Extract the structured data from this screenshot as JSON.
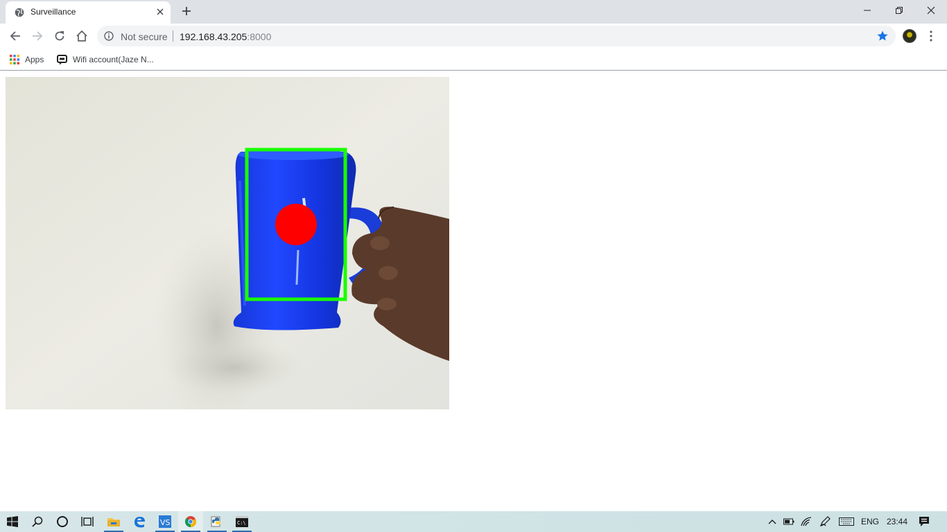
{
  "browser": {
    "tab": {
      "title": "Surveillance",
      "favicon": "globe-icon"
    },
    "address": {
      "security_label": "Not secure",
      "host": "192.168.43.205",
      "port": ":8000"
    },
    "bookmarks": [
      {
        "label": "Apps",
        "icon": "apps-grid-icon"
      },
      {
        "label": "Wifi account(Jaze N...",
        "icon": "chat-icon"
      }
    ]
  },
  "taskbar": {
    "language": "ENG",
    "time": "23:44",
    "pinned": [
      "start-icon",
      "search-icon",
      "cortana-icon",
      "task-view-icon",
      "file-explorer-icon",
      "edge-icon",
      "visual-studio-icon",
      "chrome-icon",
      "python-icon",
      "cmd-icon"
    ]
  },
  "colors": {
    "mug_blue": "#1a3cf0",
    "bounding_box": "#19ff00",
    "center_marker": "#ff0000",
    "star": "#1a73e8"
  }
}
